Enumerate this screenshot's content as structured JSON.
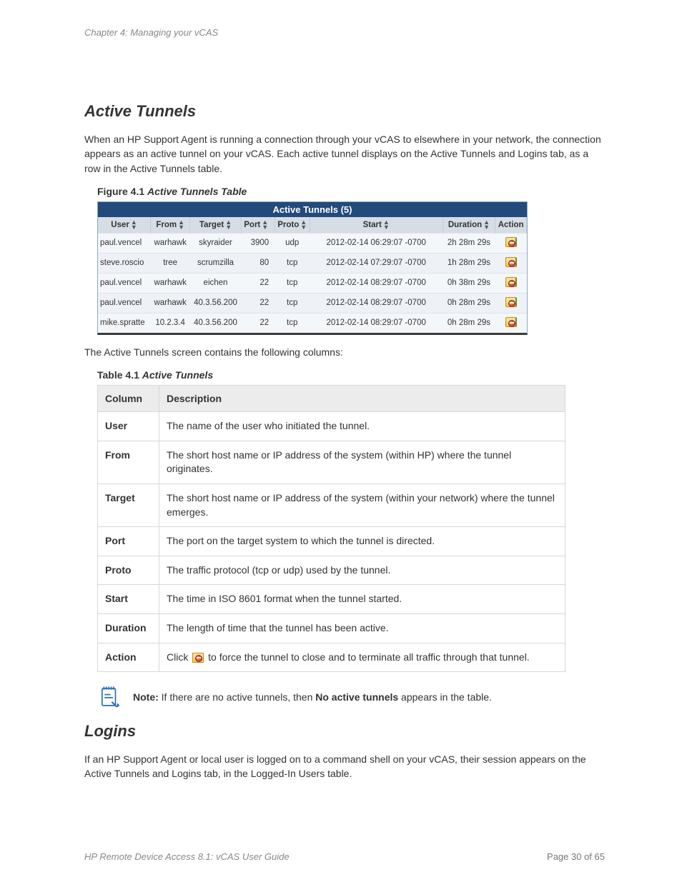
{
  "chapter_header": "Chapter 4: Managing your vCAS",
  "section1": {
    "title": "Active Tunnels",
    "intro": "When an HP Support Agent is running a connection through your vCAS to elsewhere in your network, the connection appears as an active tunnel on your vCAS. Each active tunnel displays on the Active Tunnels and Logins tab, as a row in the Active Tunnels table.",
    "figure_prefix": "Figure 4.1 ",
    "figure_title": "Active Tunnels Table",
    "tunnels_title": "Active Tunnels (5)",
    "headers": {
      "user": "User",
      "from": "From",
      "target": "Target",
      "port": "Port",
      "proto": "Proto",
      "start": "Start",
      "duration": "Duration",
      "action": "Action"
    },
    "rows": [
      {
        "user": "paul.vencel",
        "from": "warhawk",
        "target": "skyraider",
        "port": "3900",
        "proto": "udp",
        "start": "2012-02-14 06:29:07 -0700",
        "duration": "2h 28m 29s"
      },
      {
        "user": "steve.roscio",
        "from": "tree",
        "target": "scrumzilla",
        "port": "80",
        "proto": "tcp",
        "start": "2012-02-14 07:29:07 -0700",
        "duration": "1h 28m 29s"
      },
      {
        "user": "paul.vencel",
        "from": "warhawk",
        "target": "eichen",
        "port": "22",
        "proto": "tcp",
        "start": "2012-02-14 08:29:07 -0700",
        "duration": "0h 38m 29s"
      },
      {
        "user": "paul.vencel",
        "from": "warhawk",
        "target": "40.3.56.200",
        "port": "22",
        "proto": "tcp",
        "start": "2012-02-14 08:29:07 -0700",
        "duration": "0h 28m 29s"
      },
      {
        "user": "mike.spratte",
        "from": "10.2.3.4",
        "target": "40.3.56.200",
        "port": "22",
        "proto": "tcp",
        "start": "2012-02-14 08:29:07 -0700",
        "duration": "0h 28m 29s"
      }
    ],
    "after_figure": "The Active Tunnels screen contains the following columns:",
    "table_prefix": "Table 4.1 ",
    "table_title": "Active Tunnels",
    "desc_headers": {
      "col": "Column",
      "desc": "Description"
    },
    "desc_rows": [
      {
        "name": "User",
        "desc": "The name of the user who initiated the tunnel."
      },
      {
        "name": "From",
        "desc": "The short host name or IP address of the system (within HP) where the tunnel originates."
      },
      {
        "name": "Target",
        "desc": "The short host name or IP address of the system (within your network) where the tunnel emerges."
      },
      {
        "name": "Port",
        "desc": "The port on the target system to which the tunnel is directed."
      },
      {
        "name": "Proto",
        "desc": "The traffic protocol (tcp or udp) used by the tunnel."
      },
      {
        "name": "Start",
        "desc": "The time in ISO 8601 format when the tunnel started."
      },
      {
        "name": "Duration",
        "desc": "The length of time that the tunnel has been active."
      }
    ],
    "action_row": {
      "name": "Action",
      "pre": "Click ",
      "post": " to force the tunnel to close and to terminate all traffic through that tunnel."
    },
    "note_label": "Note:",
    "note_mid": " If there are no active tunnels, then ",
    "note_bold": "No active tunnels",
    "note_end": " appears in the table."
  },
  "section2": {
    "title": "Logins",
    "body": "If an HP Support Agent or local user is logged on to a command shell on your vCAS, their session appears on the Active Tunnels and Logins tab, in the Logged-In Users table."
  },
  "footer": {
    "left": "HP Remote Device Access 8.1: vCAS User Guide",
    "right": "Page 30 of 65"
  }
}
